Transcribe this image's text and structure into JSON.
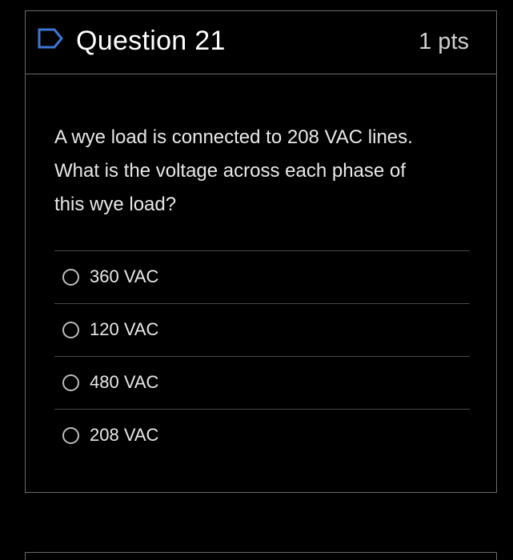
{
  "question": {
    "title": "Question 21",
    "points": "1 pts",
    "flag_icon": "flag-outline-icon",
    "text": "A wye load is connected to 208 VAC lines.  What is the voltage across each phase of this wye load?"
  },
  "answers": [
    {
      "label": "360 VAC"
    },
    {
      "label": "120 VAC"
    },
    {
      "label": "480 VAC"
    },
    {
      "label": "208 VAC"
    }
  ],
  "colors": {
    "background": "#000000",
    "border": "#6b6b6b",
    "accent_flag": "#3b78d6",
    "text": "#e8e8e8"
  }
}
